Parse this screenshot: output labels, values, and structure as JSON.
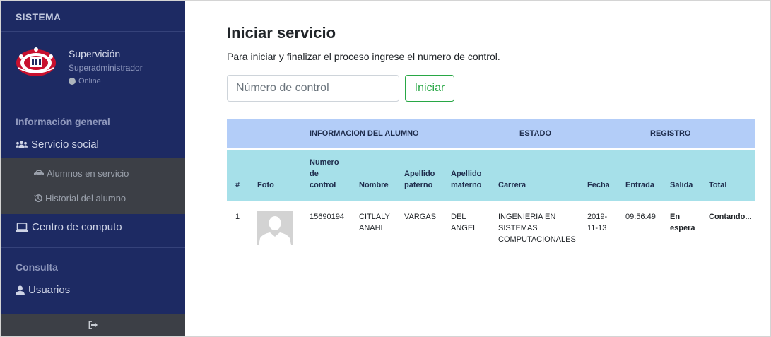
{
  "sidebar": {
    "brand": "SISTEMA",
    "user": {
      "name": "Supervición",
      "role": "Superadministrador",
      "status": "Online"
    },
    "sections": [
      {
        "heading": "Información general"
      },
      {
        "heading": "Consulta"
      }
    ],
    "items": {
      "servicio_social": "Servicio social",
      "alumnos_en_servicio": "Alumnos en servicio",
      "historial_del_alumno": "Historial del alumno",
      "centro_de_computo": "Centro de computo",
      "usuarios": "Usuarios"
    },
    "icons": [
      "users-icon",
      "car-icon",
      "history-icon",
      "laptop-icon",
      "user-icon",
      "sign-out-icon"
    ]
  },
  "main": {
    "title": "Iniciar servicio",
    "description": "Para iniciar y finalizar el proceso ingrese el numero de control.",
    "input": {
      "placeholder": "Número de control",
      "value": ""
    },
    "start_button": "Iniciar",
    "table": {
      "groups": [
        "INFORMACION DEL ALUMNO",
        "ESTADO",
        "REGISTRO"
      ],
      "columns": {
        "num": "#",
        "foto": "Foto",
        "numero_control_1": "Numero",
        "numero_control_2": "de",
        "numero_control_3": "control",
        "nombre": "Nombre",
        "paterno_1": "Apellido",
        "paterno_2": "paterno",
        "materno_1": "Apellido",
        "materno_2": "materno",
        "carrera": "Carrera",
        "fecha": "Fecha",
        "entrada": "Entrada",
        "salida": "Salida",
        "total": "Total"
      },
      "rows": [
        {
          "num": "1",
          "numero_control": "15690194",
          "nombre_1": "CITLALY",
          "nombre_2": "ANAHI",
          "apellido_paterno": "VARGAS",
          "apellido_materno_1": "DEL",
          "apellido_materno_2": "ANGEL",
          "carrera_1": "INGENIERIA EN",
          "carrera_2": "SISTEMAS",
          "carrera_3": "COMPUTACIONALES",
          "fecha_1": "2019-",
          "fecha_2": "11-13",
          "entrada": "09:56:49",
          "salida_1": "En",
          "salida_2": "espera",
          "total": "Contando..."
        }
      ]
    }
  },
  "colors": {
    "sidebar_bg": "#1d2a63",
    "submenu_bg": "#3c3f46",
    "group_header_bg": "#b3cdf8",
    "column_header_bg": "#a6e0e9",
    "success": "#28a745",
    "counting": "#6f1fe0"
  }
}
